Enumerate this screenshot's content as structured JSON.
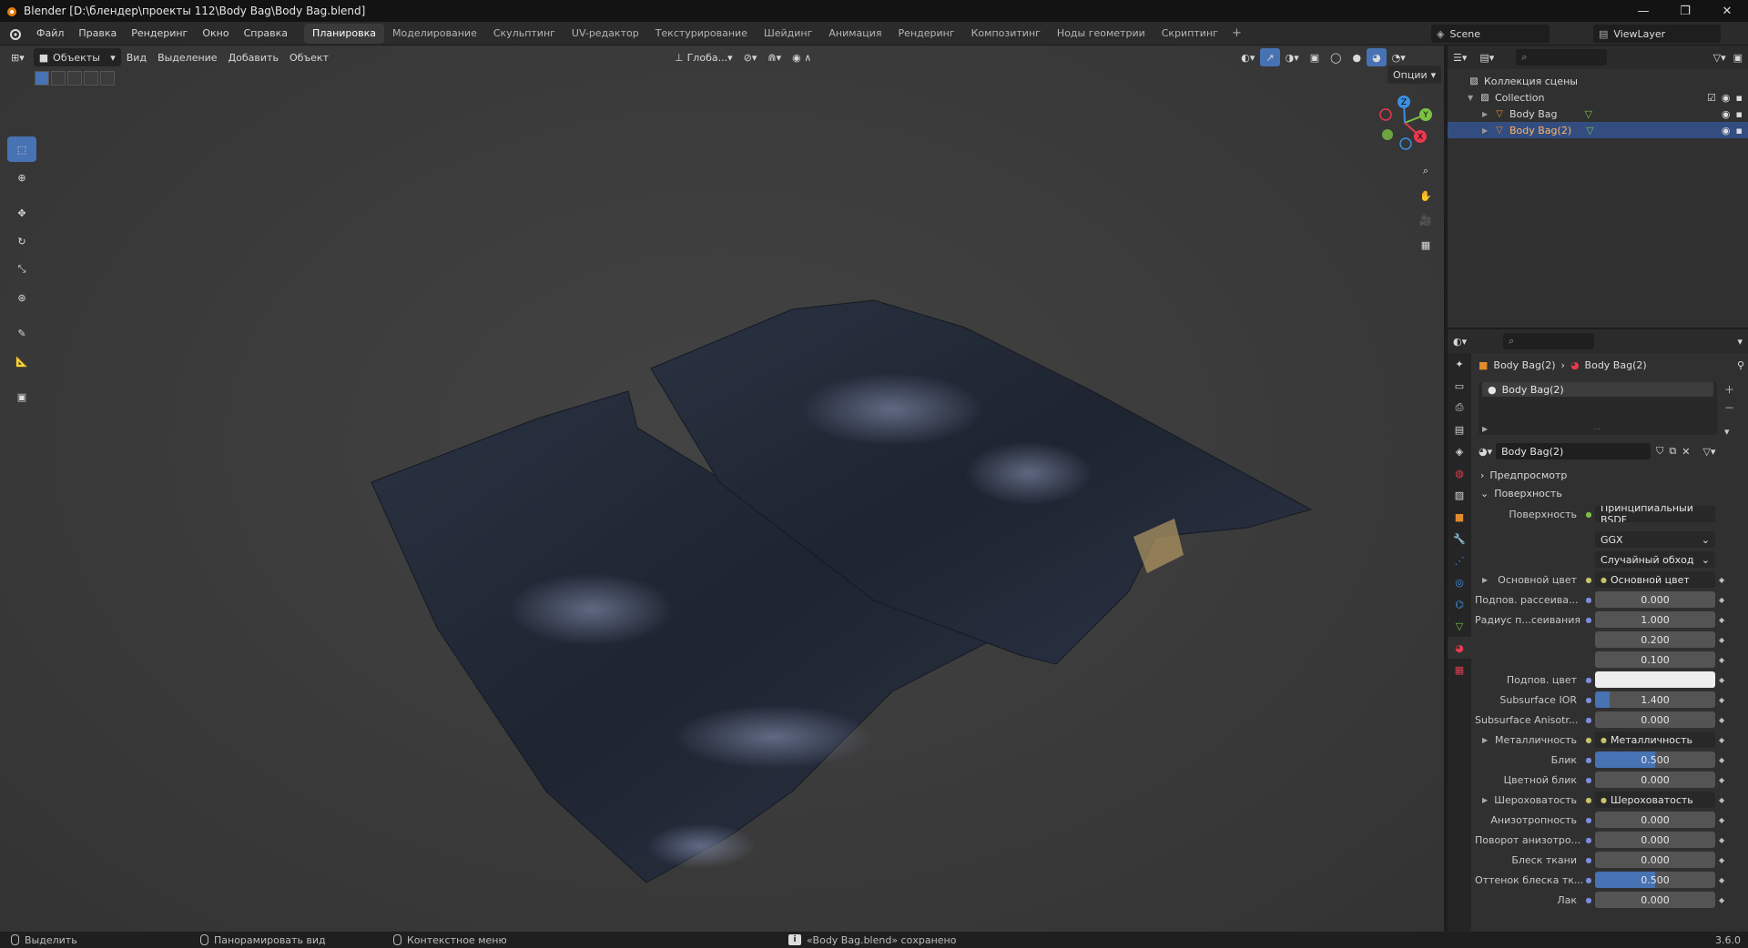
{
  "window": {
    "title": "Blender [D:\\блендер\\проекты 112\\Body Bag\\Body Bag.blend]",
    "controls": [
      "—",
      "❐",
      "✕"
    ]
  },
  "menu": [
    "Файл",
    "Правка",
    "Рендеринг",
    "Окно",
    "Справка"
  ],
  "workspaces": [
    "Планировка",
    "Моделирование",
    "Скульптинг",
    "UV-редактор",
    "Текстурирование",
    "Шейдинг",
    "Анимация",
    "Рендеринг",
    "Композитинг",
    "Ноды геометрии",
    "Скриптинг"
  ],
  "active_workspace": "Планировка",
  "scene": {
    "name": "Scene",
    "view_layer": "ViewLayer"
  },
  "viewport": {
    "mode": "Объекты",
    "menus": [
      "Вид",
      "Выделение",
      "Добавить",
      "Объект"
    ],
    "orientation": "Глоба...",
    "options": "Опции",
    "gizmo_axes": [
      "X",
      "Y",
      "Z"
    ]
  },
  "outliner": {
    "root": "Коллекция сцены",
    "collection": "Collection",
    "objects": [
      {
        "name": "Body Bag",
        "selected": false
      },
      {
        "name": "Body Bag(2)",
        "selected": true
      }
    ]
  },
  "properties": {
    "breadcrumb": [
      "Body Bag(2)",
      "Body Bag(2)"
    ],
    "slot": "Body Bag(2)",
    "material_name": "Body Bag(2)",
    "panels": {
      "preview": "Предпросмотр",
      "surface": "Поверхность"
    },
    "surface_label": "Поверхность",
    "surface_value": "Принципиальный BSDF",
    "distribution": "GGX",
    "subsurface_method": "Случайный обход",
    "rows": [
      {
        "label": "Основной цвет",
        "value": "Основной цвет",
        "kind": "link",
        "expand": true
      },
      {
        "label": "Подпов. рассеива...",
        "value": "0.000",
        "kind": "num",
        "fill": 0
      },
      {
        "label": "Радиус п...сеивания",
        "value": "1.000",
        "kind": "num",
        "fill": 0
      },
      {
        "label": "",
        "value": "0.200",
        "kind": "num",
        "fill": 0
      },
      {
        "label": "",
        "value": "0.100",
        "kind": "num",
        "fill": 0
      },
      {
        "label": "Подпов. цвет",
        "value": "",
        "kind": "color"
      },
      {
        "label": "Subsurface IOR",
        "value": "1.400",
        "kind": "num",
        "fill": 0.12
      },
      {
        "label": "Subsurface Anisotr...",
        "value": "0.000",
        "kind": "num",
        "fill": 0
      },
      {
        "label": "Металличность",
        "value": "Металличность",
        "kind": "link",
        "expand": true
      },
      {
        "label": "Блик",
        "value": "0.500",
        "kind": "num",
        "fill": 0.5
      },
      {
        "label": "Цветной блик",
        "value": "0.000",
        "kind": "num",
        "fill": 0
      },
      {
        "label": "Шероховатость",
        "value": "Шероховатость",
        "kind": "link",
        "expand": true
      },
      {
        "label": "Анизотропность",
        "value": "0.000",
        "kind": "num",
        "fill": 0
      },
      {
        "label": "Поворот анизотро...",
        "value": "0.000",
        "kind": "num",
        "fill": 0
      },
      {
        "label": "Блеск ткани",
        "value": "0.000",
        "kind": "num",
        "fill": 0
      },
      {
        "label": "Оттенок блеска тк...",
        "value": "0.500",
        "kind": "num",
        "fill": 0.5
      },
      {
        "label": "Лак",
        "value": "0.000",
        "kind": "num",
        "fill": 0
      }
    ]
  },
  "status": {
    "select": "Выделить",
    "pan": "Панорамировать вид",
    "context": "Контекстное меню",
    "message": "«Body Bag.blend» сохранено",
    "version": "3.6.0"
  },
  "colors": {
    "accent": "#4772b3",
    "selected_row": "#334d80",
    "axis_x": "#e8394f",
    "axis_y": "#7bc142",
    "axis_z": "#3d8fe0"
  }
}
